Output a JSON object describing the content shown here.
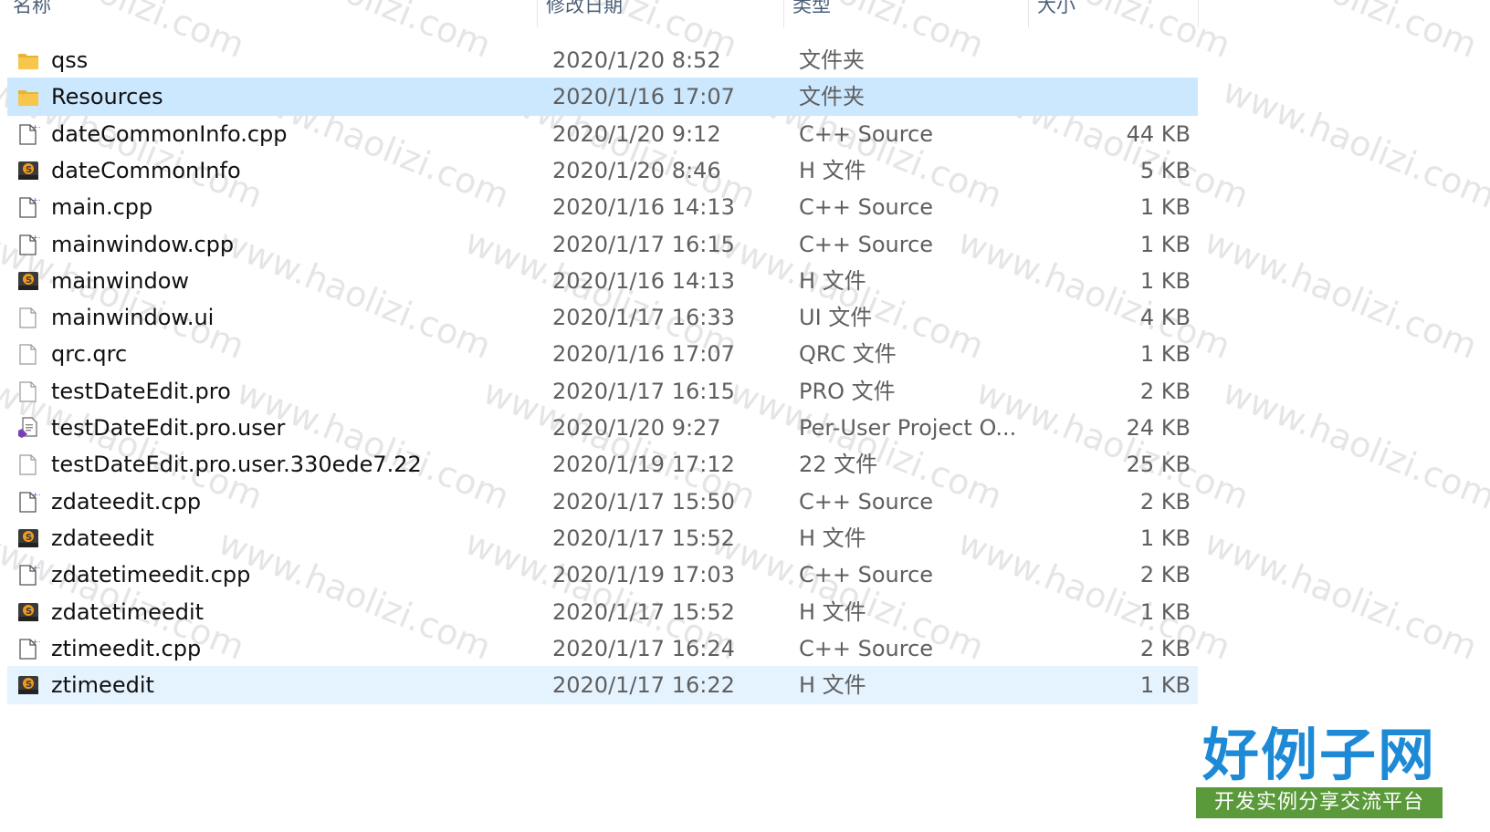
{
  "header": {
    "name": "名称",
    "date": "修改日期",
    "type": "类型",
    "size": "大小"
  },
  "files": [
    {
      "name": "qss",
      "date": "2020/1/20 8:52",
      "type": "文件夹",
      "size": "",
      "icon": "folder-icon"
    },
    {
      "name": "Resources",
      "date": "2020/1/16 17:07",
      "type": "文件夹",
      "size": "",
      "icon": "folder-icon",
      "state": "selected"
    },
    {
      "name": "dateCommonInfo.cpp",
      "date": "2020/1/20 9:12",
      "type": "C++ Source",
      "size": "44 KB",
      "icon": "cpp-file-icon"
    },
    {
      "name": "dateCommonInfo",
      "date": "2020/1/20 8:46",
      "type": "H 文件",
      "size": "5 KB",
      "icon": "sublime-file-icon"
    },
    {
      "name": "main.cpp",
      "date": "2020/1/16 14:13",
      "type": "C++ Source",
      "size": "1 KB",
      "icon": "cpp-file-icon"
    },
    {
      "name": "mainwindow.cpp",
      "date": "2020/1/17 16:15",
      "type": "C++ Source",
      "size": "1 KB",
      "icon": "cpp-file-icon"
    },
    {
      "name": "mainwindow",
      "date": "2020/1/16 14:13",
      "type": "H 文件",
      "size": "1 KB",
      "icon": "sublime-file-icon"
    },
    {
      "name": "mainwindow.ui",
      "date": "2020/1/17 16:33",
      "type": "UI 文件",
      "size": "4 KB",
      "icon": "generic-file-icon"
    },
    {
      "name": "qrc.qrc",
      "date": "2020/1/16 17:07",
      "type": "QRC 文件",
      "size": "1 KB",
      "icon": "generic-file-icon"
    },
    {
      "name": "testDateEdit.pro",
      "date": "2020/1/17 16:15",
      "type": "PRO 文件",
      "size": "2 KB",
      "icon": "generic-file-icon"
    },
    {
      "name": "testDateEdit.pro.user",
      "date": "2020/1/20 9:27",
      "type": "Per-User Project O...",
      "size": "24 KB",
      "icon": "vs-project-file-icon"
    },
    {
      "name": "testDateEdit.pro.user.330ede7.22",
      "date": "2020/1/19 17:12",
      "type": "22 文件",
      "size": "25 KB",
      "icon": "generic-file-icon"
    },
    {
      "name": "zdateedit.cpp",
      "date": "2020/1/17 15:50",
      "type": "C++ Source",
      "size": "2 KB",
      "icon": "cpp-file-icon"
    },
    {
      "name": "zdateedit",
      "date": "2020/1/17 15:52",
      "type": "H 文件",
      "size": "1 KB",
      "icon": "sublime-file-icon"
    },
    {
      "name": "zdatetimeedit.cpp",
      "date": "2020/1/19 17:03",
      "type": "C++ Source",
      "size": "2 KB",
      "icon": "cpp-file-icon"
    },
    {
      "name": "zdatetimeedit",
      "date": "2020/1/17 15:52",
      "type": "H 文件",
      "size": "1 KB",
      "icon": "sublime-file-icon"
    },
    {
      "name": "ztimeedit.cpp",
      "date": "2020/1/17 16:24",
      "type": "C++ Source",
      "size": "2 KB",
      "icon": "cpp-file-icon"
    },
    {
      "name": "ztimeedit",
      "date": "2020/1/17 16:22",
      "type": "H 文件",
      "size": "1 KB",
      "icon": "sublime-file-icon",
      "state": "hover"
    }
  ],
  "watermark": {
    "text": "www.haolizi.com",
    "logo_title": "好例子网",
    "logo_subtitle": "开发实例分享交流平台"
  },
  "colors": {
    "selected": "#cce8ff",
    "hover": "#e5f3ff",
    "header_text": "#4c607a",
    "folder": "#f7c64b"
  }
}
